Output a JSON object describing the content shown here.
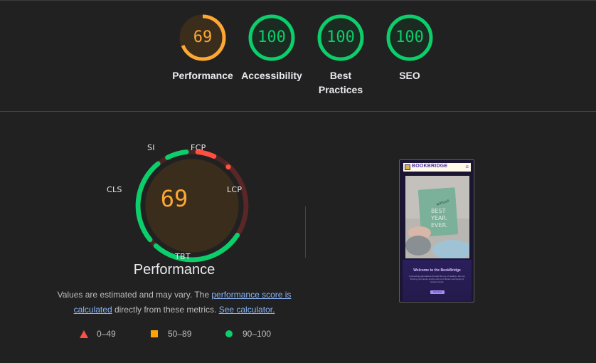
{
  "categories": [
    {
      "id": "performance",
      "score": "69",
      "label": "Performance",
      "score_fraction": 0.69,
      "status": "average"
    },
    {
      "id": "accessibility",
      "score": "100",
      "label": "Accessibility",
      "score_fraction": 1.0,
      "status": "pass"
    },
    {
      "id": "best-practices",
      "score": "100",
      "label_line1": "Best",
      "label_line2": "Practices",
      "score_fraction": 1.0,
      "status": "pass"
    },
    {
      "id": "seo",
      "score": "100",
      "label": "SEO",
      "score_fraction": 1.0,
      "status": "pass"
    }
  ],
  "performance": {
    "score": "69",
    "title": "Performance",
    "metrics": {
      "si": "SI",
      "fcp": "FCP",
      "lcp": "LCP",
      "tbt": "TBT",
      "cls": "CLS"
    },
    "note_text_1": "Values are estimated and may vary. The",
    "note_link_1": "performance score is calculated",
    "note_text_2": "directly from these metrics.",
    "note_link_2": "See calculator."
  },
  "legend": [
    {
      "range": "0–49",
      "icon": "triangle-icon",
      "color": "#ff4e42"
    },
    {
      "range": "50–89",
      "icon": "square-icon",
      "color": "#ffa400"
    },
    {
      "range": "90–100",
      "icon": "circle-icon",
      "color": "#0cce6b"
    }
  ],
  "screenshot": {
    "logo": "BOOKBRIDGE",
    "menu": "≡",
    "welcome": "Welcome to the BookBridge",
    "description": "Connecting generations through the joy of reading. Join our thriving community and be part of a vibrant community of curious minds.",
    "button": "Join Now",
    "book_title_line1": "BEST",
    "book_title_line2": "YEAR.",
    "book_title_line3": "EVER."
  },
  "colors": {
    "pass": "#0cce6b",
    "average": "#ffa400",
    "fail": "#ff4e42",
    "background": "#212121"
  }
}
